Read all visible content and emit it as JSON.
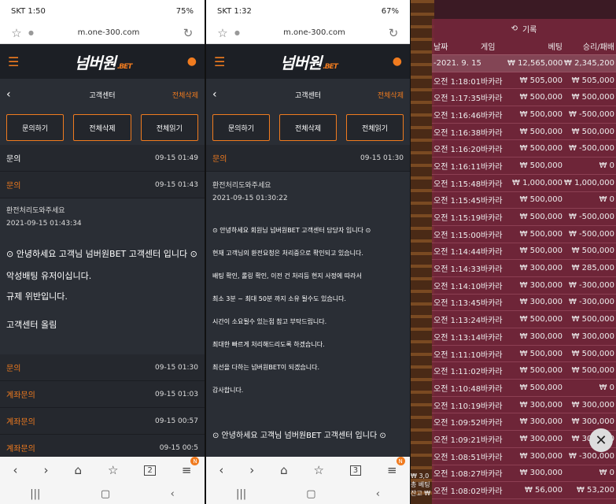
{
  "phone1": {
    "status_left": "SKT 1:50",
    "status_right": "75%",
    "url": "m.one-300.com",
    "tab_count": "2"
  },
  "phone2": {
    "status_left": "SKT 1:32",
    "status_right": "67%",
    "url": "m.one-300.com",
    "tab_count": "3"
  },
  "site": {
    "logo": "넘버원",
    "logo_suffix": ".BET",
    "page_title": "고객센터",
    "delete_all": "전체삭제",
    "btn_inquiry": "문의하기",
    "btn_delete": "전체삭제",
    "btn_read": "전체읽기"
  },
  "p1": {
    "row1": {
      "t": "문의",
      "d": "09-15 01:49"
    },
    "row2": {
      "t": "문의",
      "d": "09-15 01:43"
    },
    "q_text": "환전처리도와주세요",
    "q_time": "2021-09-15 01:43:34",
    "a_lines": [
      "⊙ 안녕하세요 고객님 넘버원BET 고객센터 입니다 ⊙",
      "악성배팅 유저이십니다.",
      "규제 위반입니다.",
      "고객센터 올림"
    ],
    "rows": [
      {
        "t": "문의",
        "d": "09-15 01:30"
      },
      {
        "t": "계좌문의",
        "d": "09-15 01:03"
      },
      {
        "t": "계좌문의",
        "d": "09-15 00:57"
      },
      {
        "t": "계좌문의",
        "d": "09-15 00:5"
      }
    ]
  },
  "p2": {
    "row1": {
      "t": "문의",
      "d": "09-15 01:30"
    },
    "q_text": "환전처리도와주세요",
    "q_time": "2021-09-15 01:30:22",
    "a_lines": [
      "⊙ 안녕하세요 회원님 넘버원BET 고객센터 담당자 입니다 ⊙",
      "현재 고객님의 환전요청은 처리중으로 확인되고 있습니다.",
      "배팅 확인, 롤링 확인, 이전 건 처리등 현지 사정에 따라서",
      "최소 3분 ~ 최대 50분 까지 소유 될수도 있습니다.",
      "시간이 소요될수 있는점 참고 부탁드립니다.",
      "최대한 빠르게 처리해드리도록 하겠습니다.",
      "최선을 다하는 넘버원BET이 되겠습니다.",
      "감사합니다."
    ],
    "footer_line": "⊙ 안녕하세요 고객님 넘버원BET 고객센터 입니다 ⊙"
  },
  "history": {
    "title": "기록",
    "headers": [
      "날짜",
      "게임",
      "베팅",
      "승리/패배"
    ],
    "summary": [
      "-2021. 9. 15.",
      "",
      "₩ 12,565,000",
      "₩ 2,345,200"
    ],
    "rows": [
      [
        "오전 1:18:01",
        "바카라",
        "₩ 505,000",
        "₩ 505,000"
      ],
      [
        "오전 1:17:35",
        "바카라",
        "₩ 500,000",
        "₩ 500,000"
      ],
      [
        "오전 1:16:46",
        "바카라",
        "₩ 500,000",
        "₩ -500,000"
      ],
      [
        "오전 1:16:38",
        "바카라",
        "₩ 500,000",
        "₩ 500,000"
      ],
      [
        "오전 1:16:20",
        "바카라",
        "₩ 500,000",
        "₩ -500,000"
      ],
      [
        "오전 1:16:11",
        "바카라",
        "₩ 500,000",
        "₩ 0"
      ],
      [
        "오전 1:15:48",
        "바카라",
        "₩ 1,000,000",
        "₩ 1,000,000"
      ],
      [
        "오전 1:15:45",
        "바카라",
        "₩ 500,000",
        "₩ 0"
      ],
      [
        "오전 1:15:19",
        "바카라",
        "₩ 500,000",
        "₩ -500,000"
      ],
      [
        "오전 1:15:00",
        "바카라",
        "₩ 500,000",
        "₩ -500,000"
      ],
      [
        "오전 1:14:44",
        "바카라",
        "₩ 500,000",
        "₩ 500,000"
      ],
      [
        "오전 1:14:33",
        "바카라",
        "₩ 300,000",
        "₩ 285,000"
      ],
      [
        "오전 1:14:10",
        "바카라",
        "₩ 300,000",
        "₩ -300,000"
      ],
      [
        "오전 1:13:45",
        "바카라",
        "₩ 300,000",
        "₩ -300,000"
      ],
      [
        "오전 1:13:24",
        "바카라",
        "₩ 500,000",
        "₩ 500,000"
      ],
      [
        "오전 1:13:14",
        "바카라",
        "₩ 300,000",
        "₩ 300,000"
      ],
      [
        "오전 1:11:10",
        "바카라",
        "₩ 500,000",
        "₩ 500,000"
      ],
      [
        "오전 1:11:02",
        "바카라",
        "₩ 500,000",
        "₩ 500,000"
      ],
      [
        "오전 1:10:48",
        "바카라",
        "₩ 500,000",
        "₩ 0"
      ],
      [
        "오전 1:10:19",
        "바카라",
        "₩ 300,000",
        "₩ 300,000"
      ],
      [
        "오전 1:09:52",
        "바카라",
        "₩ 300,000",
        "₩ 300,000"
      ],
      [
        "오전 1:09:21",
        "바카라",
        "₩ 300,000",
        "₩ 300,000"
      ],
      [
        "오전 1:08:51",
        "바카라",
        "₩ 300,000",
        "₩ -300,000"
      ],
      [
        "오전 1:08:27",
        "바카라",
        "₩ 300,000",
        "₩ 0"
      ],
      [
        "오전 1:08:02",
        "바카라",
        "₩ 56,000",
        "₩ 53,200"
      ]
    ],
    "overlay_text": "₩ 3,0 총 베팅 잔고 ₩"
  }
}
